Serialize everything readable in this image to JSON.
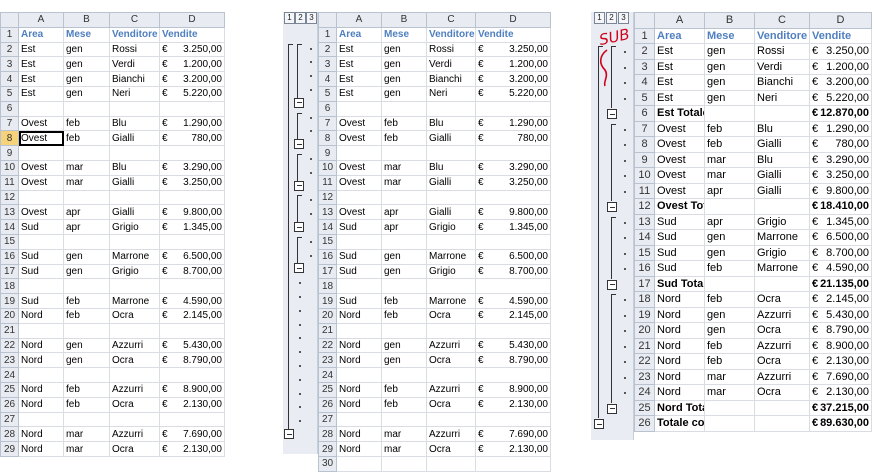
{
  "columns": [
    "A",
    "B",
    "C",
    "D"
  ],
  "headers": [
    "Area",
    "Mese",
    "Venditore",
    "Vendite"
  ],
  "currency": "€",
  "level_buttons": [
    "1",
    "2",
    "3"
  ],
  "sheet1": {
    "rows": [
      [
        "1",
        "Area",
        "Mese",
        "Venditore",
        "Vendite"
      ],
      [
        "2",
        "Est",
        "gen",
        "Rossi",
        "3.250,00"
      ],
      [
        "3",
        "Est",
        "gen",
        "Verdi",
        "1.200,00"
      ],
      [
        "4",
        "Est",
        "gen",
        "Bianchi",
        "3.200,00"
      ],
      [
        "5",
        "Est",
        "gen",
        "Neri",
        "5.220,00"
      ],
      [
        "6",
        "",
        "",
        "",
        ""
      ],
      [
        "7",
        "Ovest",
        "feb",
        "Blu",
        "1.290,00"
      ],
      [
        "8",
        "Ovest",
        "feb",
        "Gialli",
        "780,00"
      ],
      [
        "9",
        "",
        "",
        "",
        ""
      ],
      [
        "10",
        "Ovest",
        "mar",
        "Blu",
        "3.290,00"
      ],
      [
        "11",
        "Ovest",
        "mar",
        "Gialli",
        "3.250,00"
      ],
      [
        "12",
        "",
        "",
        "",
        ""
      ],
      [
        "13",
        "Ovest",
        "apr",
        "Gialli",
        "9.800,00"
      ],
      [
        "14",
        "Sud",
        "apr",
        "Grigio",
        "1.345,00"
      ],
      [
        "15",
        "",
        "",
        "",
        ""
      ],
      [
        "16",
        "Sud",
        "gen",
        "Marrone",
        "6.500,00"
      ],
      [
        "17",
        "Sud",
        "gen",
        "Grigio",
        "8.700,00"
      ],
      [
        "18",
        "",
        "",
        "",
        ""
      ],
      [
        "19",
        "Sud",
        "feb",
        "Marrone",
        "4.590,00"
      ],
      [
        "20",
        "Nord",
        "feb",
        "Ocra",
        "2.145,00"
      ],
      [
        "21",
        "",
        "",
        "",
        ""
      ],
      [
        "22",
        "Nord",
        "gen",
        "Azzurri",
        "5.430,00"
      ],
      [
        "23",
        "Nord",
        "gen",
        "Ocra",
        "8.790,00"
      ],
      [
        "24",
        "",
        "",
        "",
        ""
      ],
      [
        "25",
        "Nord",
        "feb",
        "Azzurri",
        "8.900,00"
      ],
      [
        "26",
        "Nord",
        "feb",
        "Ocra",
        "2.130,00"
      ],
      [
        "27",
        "",
        "",
        "",
        ""
      ],
      [
        "28",
        "Nord",
        "mar",
        "Azzurri",
        "7.690,00"
      ],
      [
        "29",
        "Nord",
        "mar",
        "Ocra",
        "2.130,00"
      ]
    ]
  },
  "sheet2": {
    "rows": [
      [
        "1",
        "Area",
        "Mese",
        "Venditore",
        "Vendite"
      ],
      [
        "2",
        "Est",
        "gen",
        "Rossi",
        "3.250,00"
      ],
      [
        "3",
        "Est",
        "gen",
        "Verdi",
        "1.200,00"
      ],
      [
        "4",
        "Est",
        "gen",
        "Bianchi",
        "3.200,00"
      ],
      [
        "5",
        "Est",
        "gen",
        "Neri",
        "5.220,00"
      ],
      [
        "6",
        "",
        "",
        "",
        ""
      ],
      [
        "7",
        "Ovest",
        "feb",
        "Blu",
        "1.290,00"
      ],
      [
        "8",
        "Ovest",
        "feb",
        "Gialli",
        "780,00"
      ],
      [
        "9",
        "",
        "",
        "",
        ""
      ],
      [
        "10",
        "Ovest",
        "mar",
        "Blu",
        "3.290,00"
      ],
      [
        "11",
        "Ovest",
        "mar",
        "Gialli",
        "3.250,00"
      ],
      [
        "12",
        "",
        "",
        "",
        ""
      ],
      [
        "13",
        "Ovest",
        "apr",
        "Gialli",
        "9.800,00"
      ],
      [
        "14",
        "Sud",
        "apr",
        "Grigio",
        "1.345,00"
      ],
      [
        "15",
        "",
        "",
        "",
        ""
      ],
      [
        "16",
        "Sud",
        "gen",
        "Marrone",
        "6.500,00"
      ],
      [
        "17",
        "Sud",
        "gen",
        "Grigio",
        "8.700,00"
      ],
      [
        "18",
        "",
        "",
        "",
        ""
      ],
      [
        "19",
        "Sud",
        "feb",
        "Marrone",
        "4.590,00"
      ],
      [
        "20",
        "Nord",
        "feb",
        "Ocra",
        "2.145,00"
      ],
      [
        "21",
        "",
        "",
        "",
        ""
      ],
      [
        "22",
        "Nord",
        "gen",
        "Azzurri",
        "5.430,00"
      ],
      [
        "23",
        "Nord",
        "gen",
        "Ocra",
        "8.790,00"
      ],
      [
        "24",
        "",
        "",
        "",
        ""
      ],
      [
        "25",
        "Nord",
        "feb",
        "Azzurri",
        "8.900,00"
      ],
      [
        "26",
        "Nord",
        "feb",
        "Ocra",
        "2.130,00"
      ],
      [
        "27",
        "",
        "",
        "",
        ""
      ],
      [
        "28",
        "Nord",
        "mar",
        "Azzurri",
        "7.690,00"
      ],
      [
        "29",
        "Nord",
        "mar",
        "Ocra",
        "2.130,00"
      ],
      [
        "30",
        "",
        "",
        "",
        ""
      ]
    ]
  },
  "sheet3": {
    "annotation": "SUB",
    "rows": [
      [
        "1",
        "Area",
        "Mese",
        "Venditore",
        "Vendite",
        "hdr"
      ],
      [
        "2",
        "Est",
        "gen",
        "Rossi",
        "3.250,00",
        ""
      ],
      [
        "3",
        "Est",
        "gen",
        "Verdi",
        "1.200,00",
        ""
      ],
      [
        "4",
        "Est",
        "gen",
        "Bianchi",
        "3.200,00",
        ""
      ],
      [
        "5",
        "Est",
        "gen",
        "Neri",
        "5.220,00",
        ""
      ],
      [
        "6",
        "Est Totale",
        "",
        "",
        "12.870,00",
        "total"
      ],
      [
        "7",
        "Ovest",
        "feb",
        "Blu",
        "1.290,00",
        ""
      ],
      [
        "8",
        "Ovest",
        "feb",
        "Gialli",
        "780,00",
        ""
      ],
      [
        "9",
        "Ovest",
        "mar",
        "Blu",
        "3.290,00",
        ""
      ],
      [
        "10",
        "Ovest",
        "mar",
        "Gialli",
        "3.250,00",
        ""
      ],
      [
        "11",
        "Ovest",
        "apr",
        "Gialli",
        "9.800,00",
        ""
      ],
      [
        "12",
        "Ovest Totale",
        "",
        "",
        "18.410,00",
        "total"
      ],
      [
        "13",
        "Sud",
        "apr",
        "Grigio",
        "1.345,00",
        ""
      ],
      [
        "14",
        "Sud",
        "gen",
        "Marrone",
        "6.500,00",
        ""
      ],
      [
        "15",
        "Sud",
        "gen",
        "Grigio",
        "8.700,00",
        ""
      ],
      [
        "16",
        "Sud",
        "feb",
        "Marrone",
        "4.590,00",
        ""
      ],
      [
        "17",
        "Sud Totale",
        "",
        "",
        "21.135,00",
        "total"
      ],
      [
        "18",
        "Nord",
        "feb",
        "Ocra",
        "2.145,00",
        ""
      ],
      [
        "19",
        "Nord",
        "gen",
        "Azzurri",
        "5.430,00",
        ""
      ],
      [
        "20",
        "Nord",
        "gen",
        "Ocra",
        "8.790,00",
        ""
      ],
      [
        "21",
        "Nord",
        "feb",
        "Azzurri",
        "8.900,00",
        ""
      ],
      [
        "22",
        "Nord",
        "feb",
        "Ocra",
        "2.130,00",
        ""
      ],
      [
        "23",
        "Nord",
        "mar",
        "Azzurri",
        "7.690,00",
        ""
      ],
      [
        "24",
        "Nord",
        "mar",
        "Ocra",
        "2.130,00",
        ""
      ],
      [
        "25",
        "Nord Totale",
        "",
        "",
        "37.215,00",
        "total"
      ],
      [
        "26",
        "Totale complessivo",
        "",
        "",
        "89.630,00",
        "total"
      ]
    ]
  }
}
